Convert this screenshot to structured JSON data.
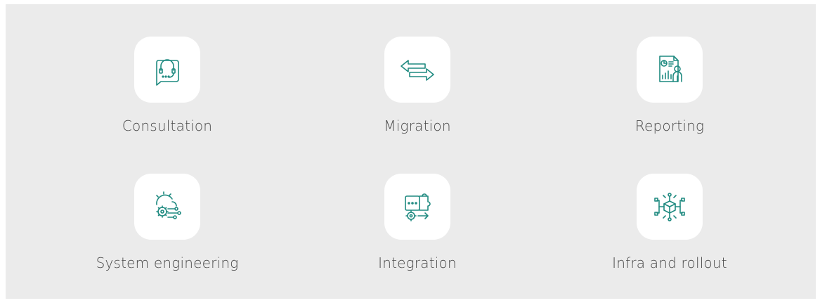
{
  "accent_color": "#1f8a80",
  "services": [
    {
      "label": "Consultation",
      "icon": "headset-chat-icon"
    },
    {
      "label": "Migration",
      "icon": "swap-arrows-icon"
    },
    {
      "label": "Reporting",
      "icon": "report-chart-icon"
    },
    {
      "label": "System engineering",
      "icon": "gears-network-icon"
    },
    {
      "label": "Integration",
      "icon": "puzzle-gear-icon"
    },
    {
      "label": "Infra and rollout",
      "icon": "cube-network-icon"
    }
  ]
}
